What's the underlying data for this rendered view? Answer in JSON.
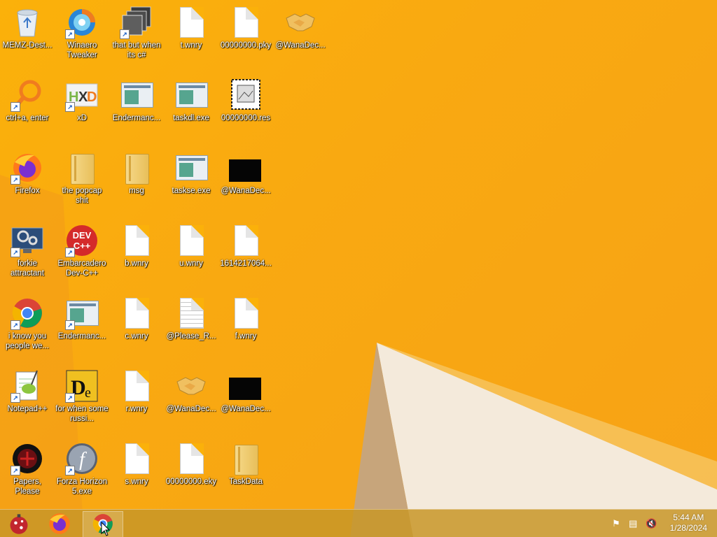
{
  "desktop": {
    "icons": [
      {
        "id": "memz",
        "label": "MEMZ-Dest...",
        "kind": "recycle"
      },
      {
        "id": "winaero",
        "label": "Winaero Tweaker",
        "kind": "winaero"
      },
      {
        "id": "csharp",
        "label": "that but when its c#",
        "kind": "stack"
      },
      {
        "id": "twnry",
        "label": "t.wnry",
        "kind": "doc"
      },
      {
        "id": "pky",
        "label": "00000000.pky",
        "kind": "doc"
      },
      {
        "id": "wanadec1",
        "label": "@WanaDec...",
        "kind": "handshake"
      },
      {
        "id": "ctrla",
        "label": "ctrl+a, enter",
        "kind": "magnifier"
      },
      {
        "id": "xd",
        "label": "xD",
        "kind": "hxd"
      },
      {
        "id": "enderman1",
        "label": "Endermanc...",
        "kind": "exe"
      },
      {
        "id": "taskdl",
        "label": "taskdl.exe",
        "kind": "exe"
      },
      {
        "id": "res",
        "label": "00000000.res",
        "kind": "res"
      },
      {
        "id": "firefox",
        "label": "Firefox",
        "kind": "firefox"
      },
      {
        "id": "popcap",
        "label": "the popcap shit",
        "kind": "folder"
      },
      {
        "id": "msg",
        "label": "msg",
        "kind": "folder"
      },
      {
        "id": "taskse",
        "label": "taskse.exe",
        "kind": "exe"
      },
      {
        "id": "wanadec2",
        "label": "@WanaDec...",
        "kind": "black"
      },
      {
        "id": "forkie",
        "label": "forkie attractant",
        "kind": "monitor"
      },
      {
        "id": "devcpp",
        "label": "Embarcadero Dev-C++",
        "kind": "devcpp"
      },
      {
        "id": "bwnry",
        "label": "b.wnry",
        "kind": "doc"
      },
      {
        "id": "uwnry",
        "label": "u.wnry",
        "kind": "doc"
      },
      {
        "id": "num1614",
        "label": "1614217064...",
        "kind": "doc"
      },
      {
        "id": "iknow",
        "label": "i know you people we...",
        "kind": "chrome"
      },
      {
        "id": "enderman2",
        "label": "Endermanc...",
        "kind": "exe"
      },
      {
        "id": "cwnry",
        "label": "c.wnry",
        "kind": "doc"
      },
      {
        "id": "please",
        "label": "@Please_R...",
        "kind": "doclined"
      },
      {
        "id": "fwnry",
        "label": "f.wnry",
        "kind": "doc"
      },
      {
        "id": "notepad",
        "label": "Notepad++",
        "kind": "notepad"
      },
      {
        "id": "forwhen",
        "label": "for when some russi...",
        "kind": "de"
      },
      {
        "id": "rwnry",
        "label": "r.wnry",
        "kind": "doc"
      },
      {
        "id": "wanadec3",
        "label": "@WanaDec...",
        "kind": "handshake"
      },
      {
        "id": "wanadec4",
        "label": "@WanaDec...",
        "kind": "black"
      },
      {
        "id": "papers",
        "label": "Papers, Please",
        "kind": "papers"
      },
      {
        "id": "forza",
        "label": "Forza Horizon 5.exe",
        "kind": "flash"
      },
      {
        "id": "swnry",
        "label": "s.wnry",
        "kind": "doc"
      },
      {
        "id": "eky",
        "label": "00000000.eky",
        "kind": "doc"
      },
      {
        "id": "taskdata",
        "label": "TaskData",
        "kind": "folder"
      }
    ]
  },
  "taskbar": {
    "apps": [
      {
        "id": "ornament",
        "name": "ornament-app-icon"
      },
      {
        "id": "firefox",
        "name": "firefox-icon"
      },
      {
        "id": "chrome",
        "name": "chrome-icon",
        "active": true
      }
    ],
    "tray": [
      "flag-icon",
      "network-icon",
      "volume-muted-icon"
    ],
    "clock": {
      "time": "5:44 AM",
      "date": "1/28/2024"
    }
  },
  "colors": {
    "wallpaper": "#fbb10a",
    "wallpaper_beige": "#f1e6d2",
    "taskbar": "#c8962a"
  }
}
